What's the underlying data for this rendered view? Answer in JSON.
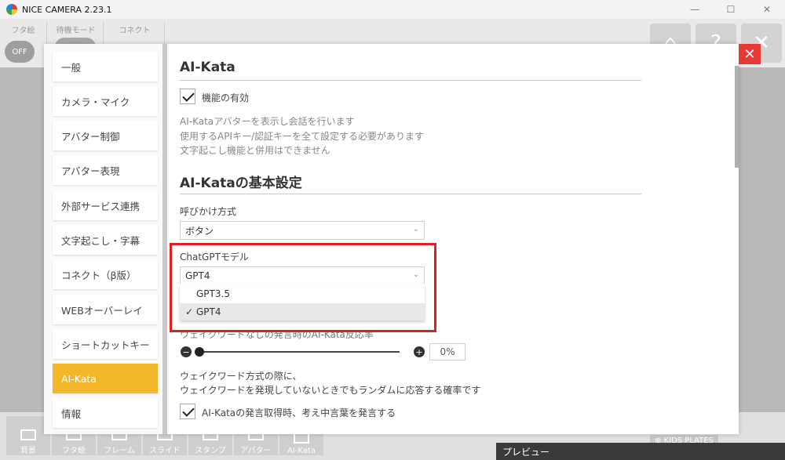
{
  "window": {
    "title": "NICE CAMERA 2.23.1",
    "minimize": "—",
    "maximize": "☐",
    "close": "✕"
  },
  "topbar": {
    "col1_label": "フタ絵",
    "col1_toggle": "OFF",
    "col2_label": "待機モード",
    "col3_label": "コネクト",
    "btn_home": "⌂",
    "btn_help": "?",
    "btn_close": "✕"
  },
  "sidebar": {
    "items": [
      {
        "label": "一般"
      },
      {
        "label": "カメラ・マイク"
      },
      {
        "label": "アバター制御"
      },
      {
        "label": "アバター表現"
      },
      {
        "label": "外部サービス連携"
      },
      {
        "label": "文字起こし・字幕"
      },
      {
        "label": "コネクト（β版）"
      },
      {
        "label": "WEBオーバーレイ"
      },
      {
        "label": "ショートカットキー"
      },
      {
        "label": "AI-Kata",
        "active": true
      },
      {
        "label": "情報"
      }
    ]
  },
  "content": {
    "section1_title": "AI-Kata",
    "enable_label": "機能の有効",
    "desc_line1": "AI-Kataアバターを表示し会話を行います",
    "desc_line2": "使用するAPIキー/認証キーを全て設定する必要があります",
    "desc_line3": "文字起こし機能と併用はできません",
    "section2_title": "AI-Kataの基本設定",
    "call_method_label": "呼びかけ方式",
    "call_method_value": "ボタン",
    "model_label": "ChatGPTモデル",
    "model_value": "GPT4",
    "model_options": [
      {
        "label": "GPT3.5",
        "selected": false
      },
      {
        "label": "GPT4",
        "selected": true
      }
    ],
    "selected_tick": "✓",
    "wake_rate_label": "ウェイクワードなしの発言時のAI-Kata反応率",
    "wake_rate_value": "0%",
    "wake_desc1": "ウェイクワード方式の際に、",
    "wake_desc2": "ウェイクワードを発現していないときでもランダムに応答する確率です",
    "thinking_label": "AI-Kataの発言取得時、考え中言葉を発言する"
  },
  "bottombar": {
    "items": [
      "背景",
      "フタ絵",
      "フレーム",
      "スライド",
      "スタンプ",
      "アバター",
      "AI-Kata"
    ],
    "preview_label": "プレビュー",
    "kids_plates": "⊕ KIDS PLATES"
  },
  "colors": {
    "accent": "#f2b72b",
    "highlight": "#e02020",
    "close": "#e53935"
  }
}
